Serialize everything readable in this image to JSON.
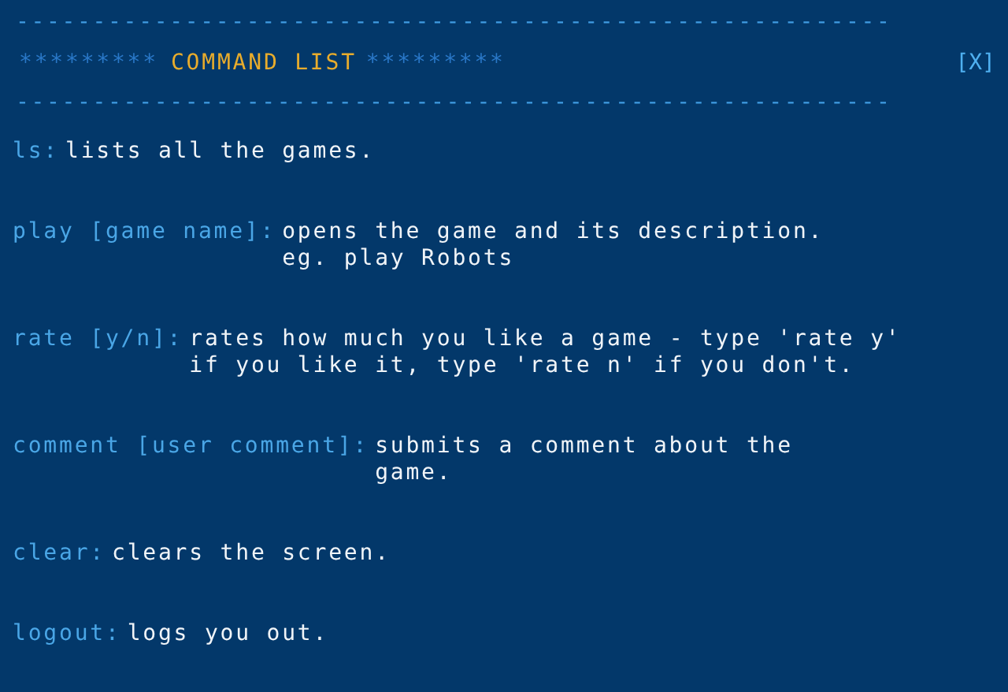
{
  "header": {
    "rule_top": "---------------------------------------------------------",
    "stars_left": "*********",
    "title": "COMMAND LIST",
    "stars_right": "*********",
    "close": "[X]",
    "rule_bottom": "---------------------------------------------------------"
  },
  "commands": [
    {
      "key": "ls:",
      "lines": [
        "lists all the games."
      ]
    },
    {
      "key": "play [game name]:",
      "lines": [
        "opens the game and its description.",
        "eg. play Robots"
      ]
    },
    {
      "key": "rate [y/n]:",
      "lines": [
        "rates how much you like a game - type 'rate y'",
        "if you like it, type 'rate n' if you don't."
      ]
    },
    {
      "key": "comment [user comment]:",
      "lines": [
        "submits a comment about the",
        "game."
      ]
    },
    {
      "key": "clear:",
      "lines": [
        "clears the screen."
      ]
    },
    {
      "key": "logout:",
      "lines": [
        "logs you out."
      ]
    }
  ]
}
